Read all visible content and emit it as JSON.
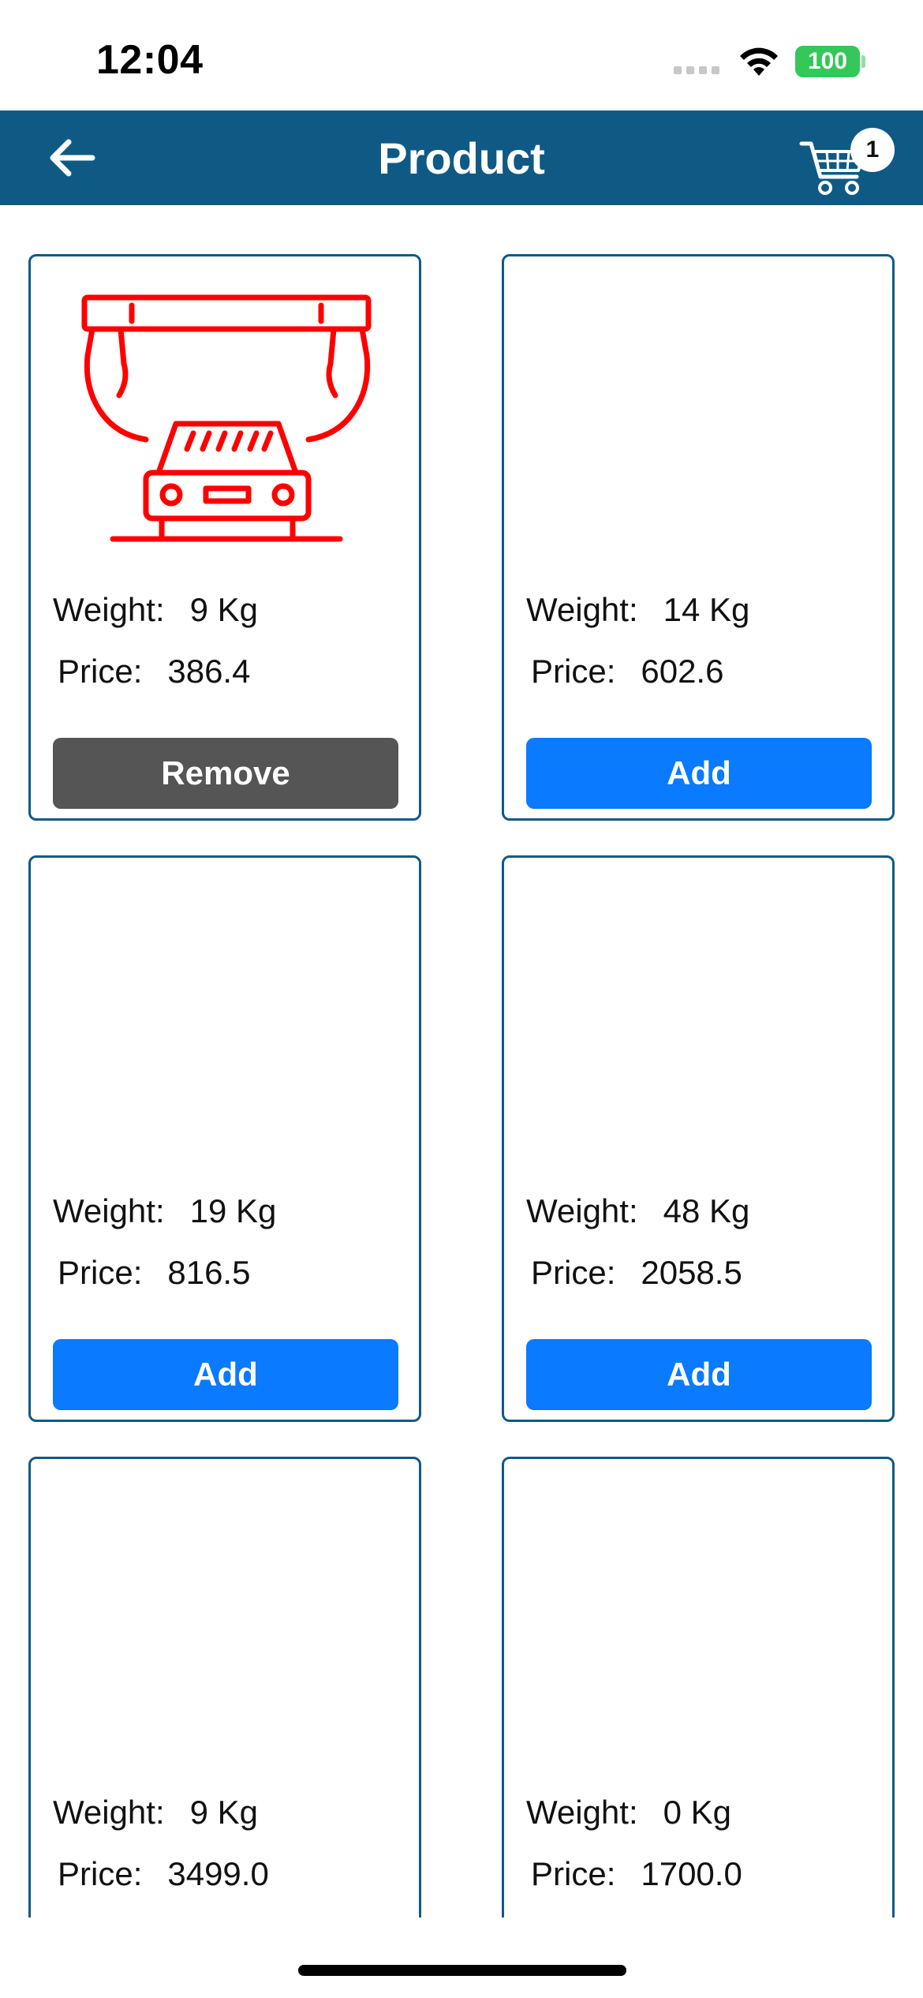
{
  "status_bar": {
    "time": "12:04",
    "battery": "100",
    "battery_color": "#34c759"
  },
  "navbar": {
    "title": "Product",
    "back_icon": "arrow-left-icon",
    "cart_icon": "shopping-cart-icon",
    "cart_count": "1",
    "background": "#0f5a85"
  },
  "labels": {
    "weight": "Weight:",
    "price": "Price:"
  },
  "colors": {
    "add_button": "#0a7aff",
    "remove_button": "#555555",
    "card_border": "#0f5a85",
    "product_icon": "#ff0000"
  },
  "products": [
    {
      "weight": "9 Kg",
      "price": "386.4",
      "action": "Remove",
      "image": "car-wash-icon"
    },
    {
      "weight": "14 Kg",
      "price": "602.6",
      "action": "Add"
    },
    {
      "weight": "19 Kg",
      "price": "816.5",
      "action": "Add"
    },
    {
      "weight": "48 Kg",
      "price": "2058.5",
      "action": "Add"
    },
    {
      "weight": "9 Kg",
      "price": "3499.0"
    },
    {
      "weight": "0 Kg",
      "price": "1700.0"
    }
  ]
}
